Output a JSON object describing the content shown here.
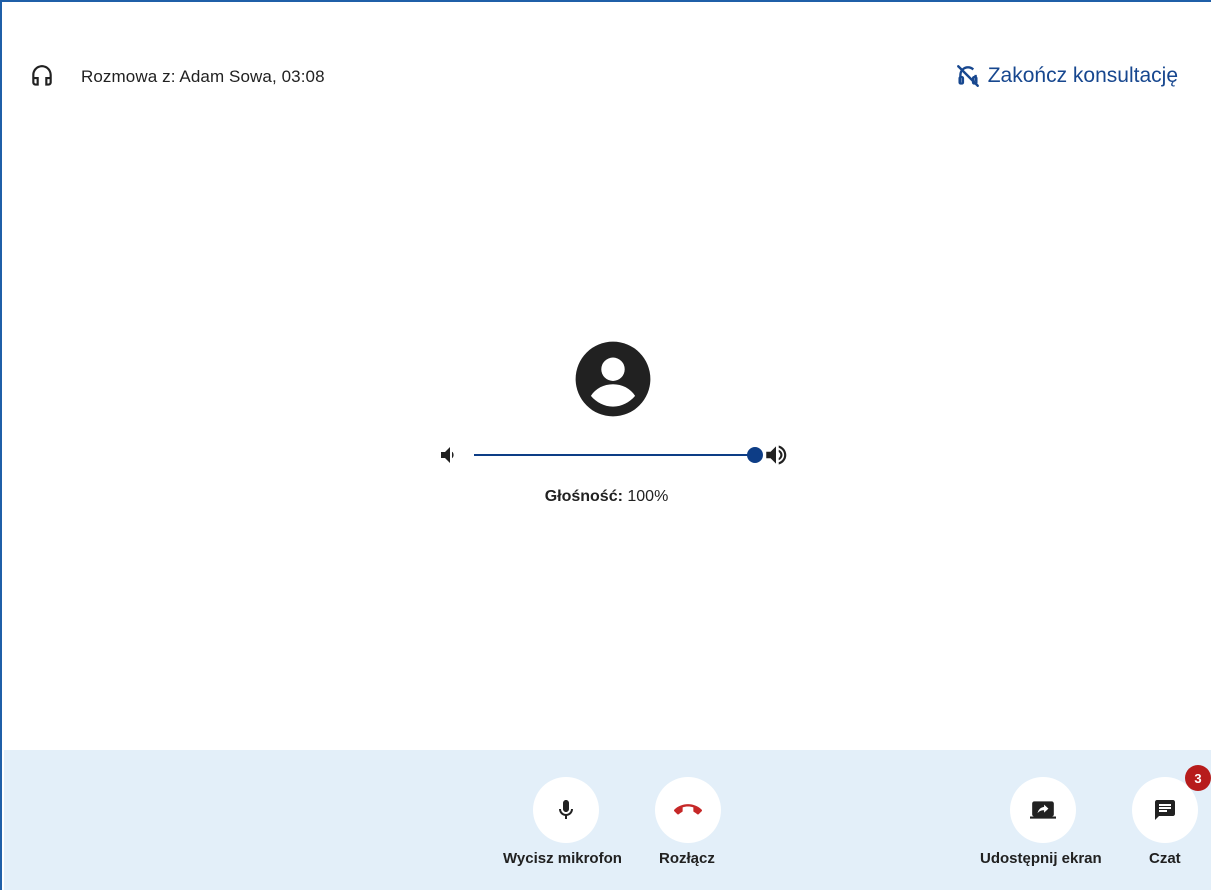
{
  "header": {
    "call_title": "Rozmowa z: Adam Sowa, 03:08",
    "end_consultation_label": "Zakończ konsultację"
  },
  "volume": {
    "label_prefix": "Głośność:",
    "value_text": "100%",
    "level": 1.0
  },
  "controls": {
    "mute": {
      "label": "Wycisz mikrofon",
      "icon": "microphone-icon"
    },
    "hangup": {
      "label": "Rozłącz",
      "icon": "hang-up-icon"
    },
    "share": {
      "label": "Udostępnij ekran",
      "icon": "screen-share-icon"
    },
    "chat": {
      "label": "Czat",
      "icon": "chat-icon",
      "badge": "3"
    }
  },
  "colors": {
    "accent": "#17478f",
    "slider": "#0d3d86",
    "bottom_bar": "#e3eff9",
    "hangup": "#c62828",
    "badge": "#b71c1c"
  }
}
